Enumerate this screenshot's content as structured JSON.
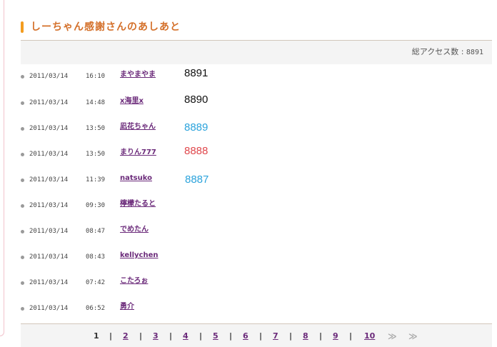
{
  "heading": {
    "title": "しーちゃん感謝さんのあしあと"
  },
  "total": {
    "label": "総アクセス数 :",
    "value": "8891"
  },
  "entries": [
    {
      "date": "2011/03/14",
      "time": "16:10",
      "name": "まやまやま",
      "number": "8891",
      "number_color": "#111111"
    },
    {
      "date": "2011/03/14",
      "time": "14:48",
      "name": "x海里x",
      "number": "8890",
      "number_color": "#111111"
    },
    {
      "date": "2011/03/14",
      "time": "13:50",
      "name": "凪花ちゃん",
      "number": "8889",
      "number_color": "#2ba3dc"
    },
    {
      "date": "2011/03/14",
      "time": "13:50",
      "name": "まりん777",
      "number": "8888",
      "number_color": "#e0474c"
    },
    {
      "date": "2011/03/14",
      "time": "11:39",
      "name": "natsuko",
      "number": "8887",
      "number_color": "#2ba3dc"
    },
    {
      "date": "2011/03/14",
      "time": "09:30",
      "name": "檸檬たると",
      "number": "",
      "number_color": "#111111"
    },
    {
      "date": "2011/03/14",
      "time": "08:47",
      "name": "でめたん",
      "number": "",
      "number_color": "#111111"
    },
    {
      "date": "2011/03/14",
      "time": "08:43",
      "name": "kellychen",
      "number": "",
      "number_color": "#111111"
    },
    {
      "date": "2011/03/14",
      "time": "07:42",
      "name": "こたろぉ",
      "number": "",
      "number_color": "#111111"
    },
    {
      "date": "2011/03/14",
      "time": "06:52",
      "name": "勇介",
      "number": "",
      "number_color": "#111111"
    }
  ],
  "pagination": {
    "current_page": "1",
    "pages": [
      "2",
      "3",
      "4",
      "5",
      "6",
      "7",
      "8",
      "9",
      "10"
    ],
    "separator": "|",
    "next_icon": "≫",
    "last_icon": "≫"
  },
  "colors": {
    "accent": "#f39c1f",
    "title": "#d4702a",
    "link": "#6b2a7a"
  }
}
